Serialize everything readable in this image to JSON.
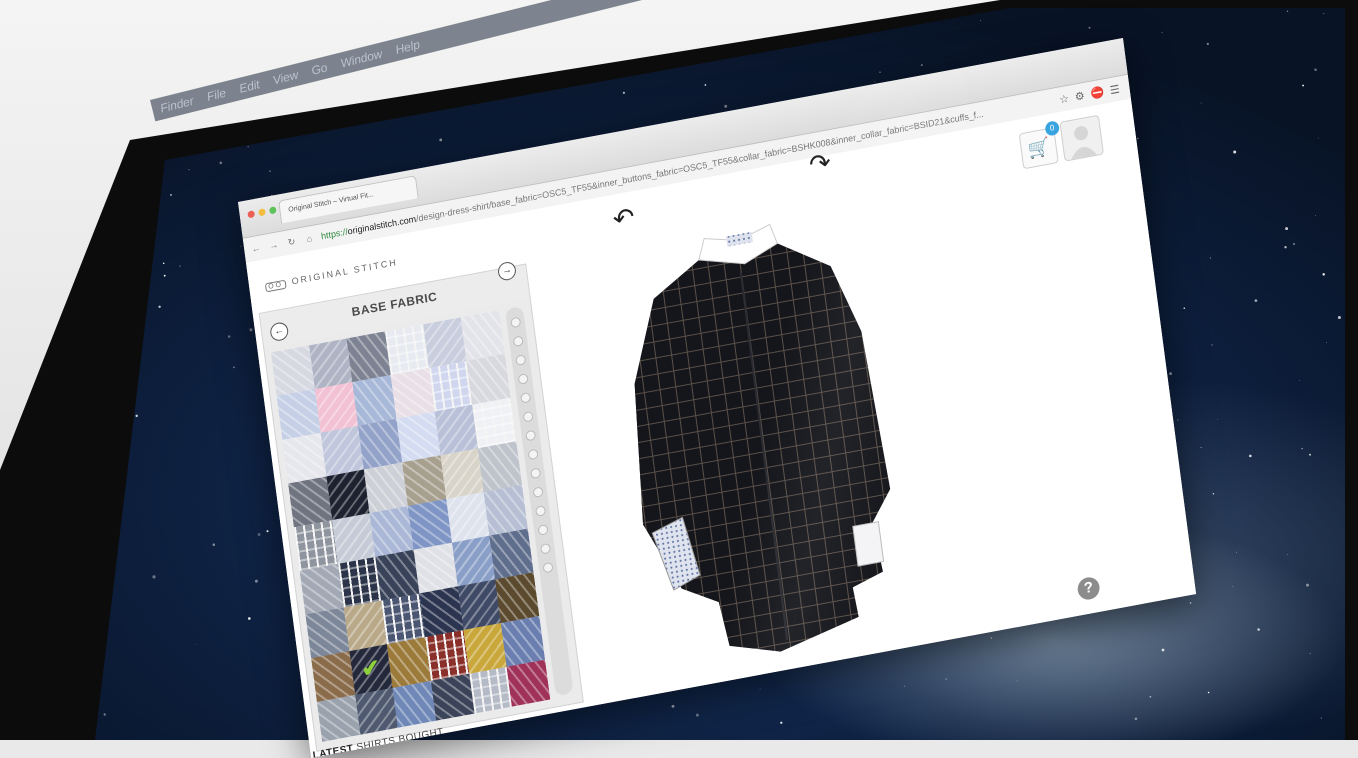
{
  "scene": {
    "colors": {
      "screen_blue": "#0f2447",
      "bezel": "#0c0c0d",
      "panel_bg": "#ebebeb",
      "check": "#8fd13a",
      "cart_badge": "#3aa4e0"
    }
  },
  "mac_menubar": {
    "items": [
      "Finder",
      "File",
      "Edit",
      "View",
      "Go",
      "Window",
      "Help"
    ]
  },
  "browser": {
    "tab_title": "Original Stitch – Virtual Fit...",
    "url_prefix": "https://",
    "url_domain": "originalstitch.com",
    "url_path": "/design-dress-shirt/base_fabric=OSC5_TF55&inner_buttons_fabric=OSC5_TF55&collar_fabric=BSHK008&inner_collar_fabric=BSID21&cuffs_f...",
    "icons": [
      "star-icon",
      "gear-icon",
      "stop-icon",
      "menu-icon"
    ]
  },
  "site": {
    "logo_text": "ORIGINAL STITCH",
    "panel_title": "BASE FABRIC",
    "cart_count": "0",
    "help_label": "?",
    "latest_bold": "LATEST",
    "latest_rest": " SHIRTS BOUGHT"
  },
  "swatches": [
    "#d7d9e2",
    "#aeb4c4",
    "#7d8392",
    "#e8eaf1",
    "#c9cede",
    "#e3e4ea",
    "#c5cfe6",
    "#f2c1d3",
    "#a7b8d8",
    "#e9dfe6",
    "#cfd6ee",
    "#d8d9df",
    "#e6e7ec",
    "#c0c6dc",
    "#93a2c8",
    "#d4dcf2",
    "#b9c1d8",
    "#f0f1f5",
    "#6f7480",
    "#1d2230",
    "#cdd0d6",
    "#a8a08f",
    "#d9d4c9",
    "#bfc3cb",
    "#8e959f",
    "#c6ccd7",
    "#aab7d6",
    "#7f95c5",
    "#dfe3ee",
    "#b6bfd3",
    "#a2a9b5",
    "#2b3448",
    "#384259",
    "#dfe1e6",
    "#8a9fc8",
    "#5f6e8d",
    "#7c879a",
    "#b9a989",
    "#4a5672",
    "#2c3550",
    "#3f4a66",
    "#5b4a2e",
    "#8a6c4a",
    "#23283a",
    "#9c7a3a",
    "#8a2f2a",
    "#c9a73a",
    "#6a7fb0",
    "#9aa2ad",
    "#4f5a70",
    "#6f88b8",
    "#3a4358",
    "#b4bac6",
    "#a0325a",
    "#3b4a7a",
    "#6b7ba7",
    "#d9b96a",
    "#c7cde0",
    "#8893ad",
    "#d0d6e6"
  ],
  "selected_swatch": 43,
  "scroll_dots": 14
}
